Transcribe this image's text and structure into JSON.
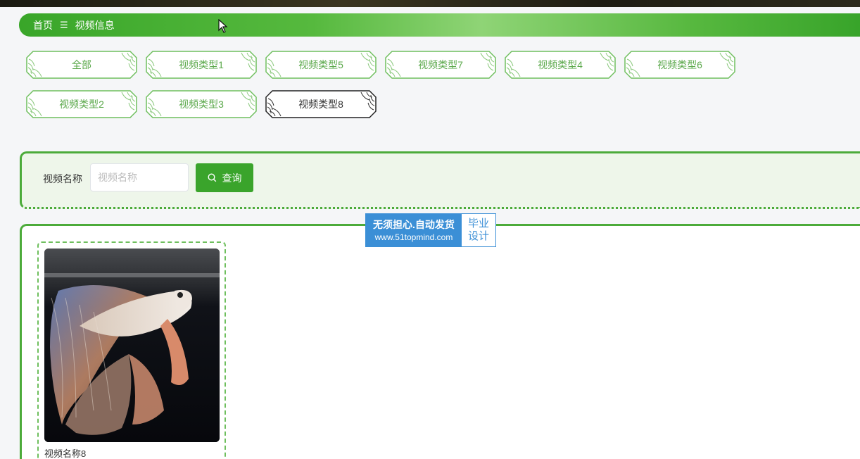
{
  "breadcrumb": {
    "home": "首页",
    "separator": "☰",
    "current": "视频信息"
  },
  "categories": [
    {
      "label": "全部",
      "active": false
    },
    {
      "label": "视频类型1",
      "active": false
    },
    {
      "label": "视频类型5",
      "active": false
    },
    {
      "label": "视频类型7",
      "active": false
    },
    {
      "label": "视频类型4",
      "active": false
    },
    {
      "label": "视频类型6",
      "active": false
    },
    {
      "label": "视频类型2",
      "active": false
    },
    {
      "label": "视频类型3",
      "active": false
    },
    {
      "label": "视频类型8",
      "active": true
    }
  ],
  "search": {
    "label": "视频名称",
    "placeholder": "视频名称",
    "button": "查询"
  },
  "videos": [
    {
      "title": "视频名称8"
    }
  ],
  "watermark": {
    "line1": "无须担心.自动发货",
    "line2": "www.51topmind.com",
    "right1": "毕业",
    "right2": "设计"
  },
  "colors": {
    "accent": "#3aa42b",
    "category_text": "#5aa84a",
    "watermark": "#3b8fd6"
  }
}
